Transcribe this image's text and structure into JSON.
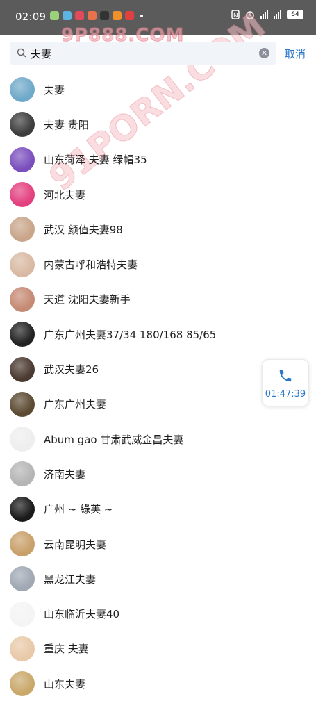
{
  "status_bar": {
    "time": "02:09",
    "battery": "64"
  },
  "watermark": {
    "primary": "9P888.COM",
    "secondary": "91PORN.COM"
  },
  "search": {
    "query": "夫妻",
    "cancel_label": "取消"
  },
  "results": [
    {
      "name": "夫妻",
      "avatar_color": "#6fa9c9"
    },
    {
      "name": "夫妻  贵阳",
      "avatar_color": "#3d3d3d"
    },
    {
      "name": "山东菏泽 夫妻  绿帽35",
      "avatar_color": "#7a4fbd"
    },
    {
      "name": "河北夫妻",
      "avatar_color": "#e3407f"
    },
    {
      "name": "武汉 颜值夫妻98",
      "avatar_color": "#c9a58a"
    },
    {
      "name": "内蒙古呼和浩特夫妻",
      "avatar_color": "#d9b9a3"
    },
    {
      "name": "天道 沈阳夫妻新手",
      "avatar_color": "#c58a73"
    },
    {
      "name": "广东广州夫妻37/34   180/168  85/65",
      "avatar_color": "#222222"
    },
    {
      "name": "武汉夫妻26",
      "avatar_color": "#4a3a30"
    },
    {
      "name": "广东广州夫妻",
      "avatar_color": "#5c4a32"
    },
    {
      "name": "Abum gao  甘肃武威金昌夫妻",
      "avatar_color": "#eeeeee"
    },
    {
      "name": "济南夫妻",
      "avatar_color": "#b5b5b5"
    },
    {
      "name": "广州 ~ 綠芙 ~",
      "avatar_color": "#1a1a1a"
    },
    {
      "name": "云南昆明夫妻",
      "avatar_color": "#c9a06a"
    },
    {
      "name": "黑龙江夫妻",
      "avatar_color": "#9fa8b3"
    },
    {
      "name": "山东临沂夫妻40",
      "avatar_color": "#f4f4f4"
    },
    {
      "name": "重庆 夫妻",
      "avatar_color": "#e8c9a8"
    },
    {
      "name": "山东夫妻",
      "avatar_color": "#c9a86a"
    }
  ],
  "call_float": {
    "duration": "01:47:39"
  },
  "colors": {
    "accent": "#2b78c9",
    "status_bar": "#5b5b5b",
    "search_bg": "#f1f4f9"
  },
  "icons": [
    "search-icon",
    "clear-icon",
    "phone-icon",
    "wifi-icon",
    "signal-icon",
    "battery-icon",
    "nfc-icon",
    "alarm-icon"
  ]
}
